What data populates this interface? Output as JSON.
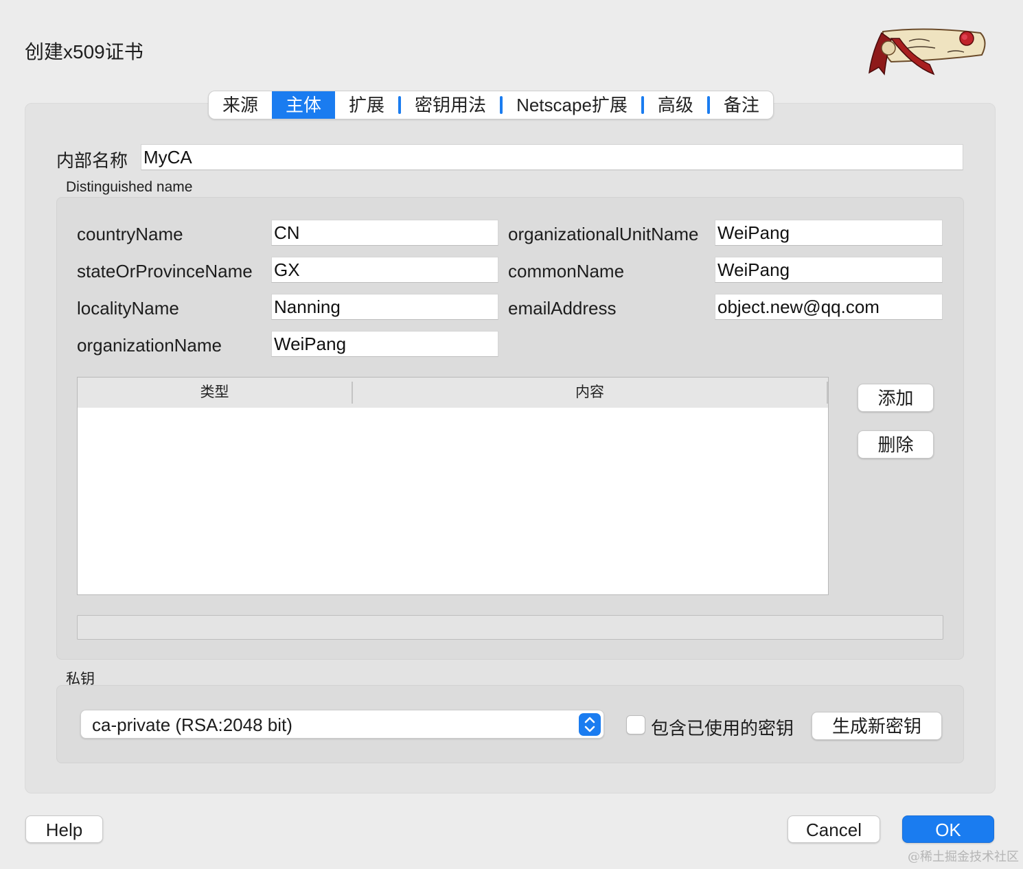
{
  "window": {
    "title": "创建x509证书"
  },
  "logo": {
    "icon": "xca-scroll-logo-icon"
  },
  "tabs": [
    {
      "label": "来源",
      "active": false
    },
    {
      "label": "主体",
      "active": true
    },
    {
      "label": "扩展",
      "active": false
    },
    {
      "label": "密钥用法",
      "active": false
    },
    {
      "label": "Netscape扩展",
      "active": false
    },
    {
      "label": "高级",
      "active": false
    },
    {
      "label": "备注",
      "active": false
    }
  ],
  "internal_name": {
    "label": "内部名称",
    "value": "MyCA"
  },
  "dn": {
    "title": "Distinguished name",
    "fields": {
      "countryName": {
        "label": "countryName",
        "value": "CN"
      },
      "stateOrProvinceName": {
        "label": "stateOrProvinceName",
        "value": "GX"
      },
      "localityName": {
        "label": "localityName",
        "value": "Nanning"
      },
      "organizationName": {
        "label": "organizationName",
        "value": "WeiPang"
      },
      "organizationalUnitName": {
        "label": "organizationalUnitName",
        "value": "WeiPang"
      },
      "commonName": {
        "label": "commonName",
        "value": "WeiPang"
      },
      "emailAddress": {
        "label": "emailAddress",
        "value": "object.new@qq.com"
      }
    },
    "table": {
      "columns": [
        "类型",
        "内容"
      ],
      "rows": []
    },
    "add_label": "添加",
    "delete_label": "删除"
  },
  "private_key": {
    "title": "私钥",
    "selected": "ca-private (RSA:2048 bit)",
    "checkbox_label": "包含已使用的密钥",
    "checkbox_checked": false,
    "generate_label": "生成新密钥"
  },
  "footer": {
    "help": "Help",
    "cancel": "Cancel",
    "ok": "OK"
  },
  "watermark": "@稀土掘金技术社区",
  "colors": {
    "accent": "#1a7cf0",
    "window_bg": "#ececec",
    "panel_bg": "#e3e3e3"
  }
}
